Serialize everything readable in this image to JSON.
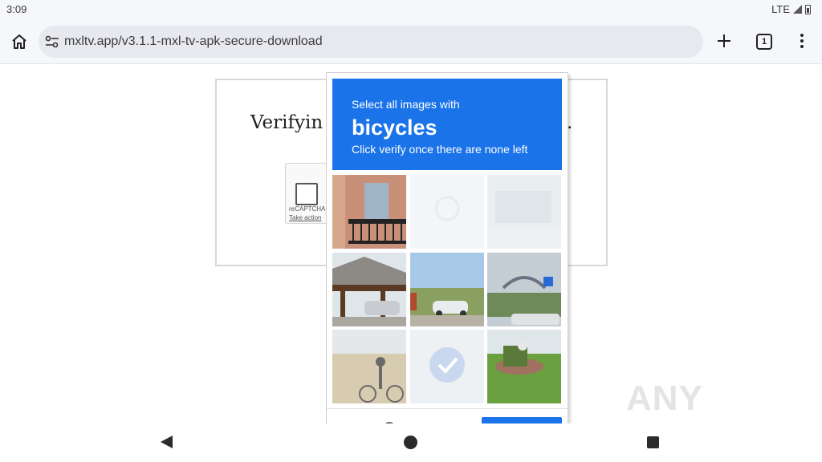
{
  "status_bar": {
    "time": "3:09",
    "network": "LTE"
  },
  "browser": {
    "url": "mxltv.app/v3.1.1-mxl-tv-apk-secure-download",
    "tab_count": "1"
  },
  "page": {
    "verifying_text": "Verifyin",
    "verifying_suffix": ".",
    "recaptcha_brand": "reCAPTCHA",
    "recaptcha_take_action": "Take action"
  },
  "challenge": {
    "line1": "Select all images with",
    "keyword": "bicycles",
    "line3": "Click verify once there are none left",
    "header_color": "#1a73e8"
  },
  "watermark": {
    "text": "ANY RUN"
  },
  "icons": [
    "home-icon",
    "tune-icon",
    "plus-icon",
    "tab-switcher-icon",
    "more-vert-icon",
    "back-icon",
    "home-circle-icon",
    "recents-icon",
    "signal-icon",
    "battery-icon"
  ]
}
